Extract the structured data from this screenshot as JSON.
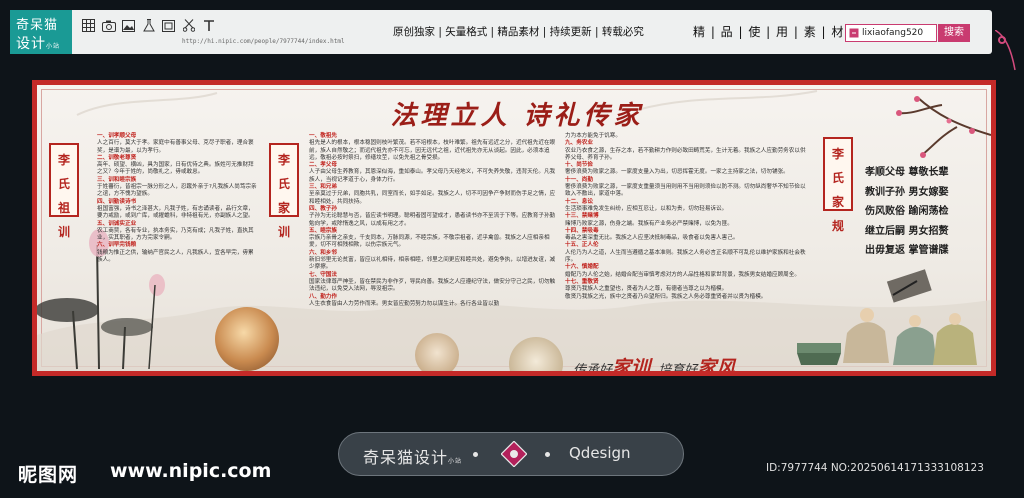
{
  "brand": {
    "line1": "奇呆猫",
    "line2": "设计",
    "line2_small": "小站"
  },
  "toolbar": {
    "icons": [
      "grid-icon",
      "camera-icon",
      "image-icon",
      "flask-icon",
      "frame-icon",
      "cut-icon",
      "text-icon"
    ],
    "url": "http://hi.nipic.com/people/7977744/index.html",
    "slogan": "原创独家 | 矢量格式 | 精品素材 | 持续更新 | 转载必究",
    "categories": "精 | 品 | 使 | 用 | 素 | 材",
    "search_value": "lixiaofang520",
    "search_button": "搜索"
  },
  "board": {
    "title": "法理立人  诗礼传家",
    "tabs": {
      "left": [
        "李",
        "氏",
        "祖",
        "训"
      ],
      "mid": [
        "李",
        "氏",
        "家",
        "训"
      ],
      "right": [
        "李",
        "氏",
        "家",
        "规"
      ]
    },
    "col1": [
      {
        "h": "一、训孝顺父母",
        "t": "人之百行，莫大于孝。家庭中有善事父母、克尽子职者，理合褒奖，是谱为最，以为孝行。"
      },
      {
        "h": "二、训敬老尊贤",
        "t": "高年、硕望、横凶，具为国家，日有优待之典。族姓可无推财拜之又？今年于姓的，尚敬礼之，毋或敢怠。"
      },
      {
        "h": "三、训和睦宗族",
        "t": "于姓蕃衍，皆祖宗一脉分形之人，忍蹴外亲于?凡我族人尚笃宗亲之谊，方不愧为望族。"
      },
      {
        "h": "四、训勤读诗书",
        "t": "祖国富强，诗书之泽甚大，凡我子姓，有志诵读者，品行文章，要力戒励，或到广库，或擢蟾科，非特祖有光，亦副族人之望。"
      },
      {
        "h": "五、训诚实正业",
        "t": "农工商贾，各有专业，执本务实，乃克有成；凡我子姓，直执其业，实其职者，方为完家令嗣。"
      },
      {
        "h": "六、训早完钱粮",
        "t": "钱粮为惟正之供，输纳产官民之人，凡我族人，宜各早完，毋累族人。"
      }
    ],
    "col2": [
      {
        "h": "一、敬祖先",
        "t": "祖先是人的根本，根本稳固则枝叶繁茂。若不培根本，枝叶难繁。祖先有远近之分，近代祖先近在眼前，族人自然敬之；而远代祖先亦不可忘，因无远代之祖，近代祖先亦无从谈起。因此，必须本追远，敬祖必按时祭扫，修缮坟茔，以免先祖之骨受损。"
      },
      {
        "h": "二、孝父母",
        "t": "人子由父母生养教育，其恩深似海，重如泰山。孝父母乃天经地义，不可失养失敬，违背天伦。凡我族人，当视记孝道于心，身体力行。"
      },
      {
        "h": "三、和兄弟",
        "t": "至亲莫过于兄弟，同胞共乳，同室而长，如手如足。我族之人，切不可因争产争财而伤手足之情，应和睦相处，共同扶持。"
      },
      {
        "h": "四、教子孙",
        "t": "子孙为无论聪慧与否，皆应读书明理。聪明者固可望成才，愚者读书亦不至流于下等。应教育子孙勤勉向学，戒除惰逸之风，以成有用之才。"
      },
      {
        "h": "五、睦宗族",
        "t": "宗族乃亲骨之亲支，千支同本，万脉同源，不睦宗族，不敬宗祖者，近乎禽兽。我族之人应相亲相爱，切不可相残相欺，以伤宗族元气。"
      },
      {
        "h": "六、和乡邻",
        "t": "新旧邻里无论贫富，皆应以礼相待，相亲相睦，邻里之间更应和睦共处，避免争执，以增进友谊，减少摩擦。"
      },
      {
        "h": "七、守国法",
        "t": "国家法律尊严神圣，皆在禁民为非作歹，导民向善。我族之人应遵纪守法，做安分守己之民，切勿触法违纪，以免受入法网，辱没祖宗。"
      },
      {
        "h": "八、勤力作",
        "t": "人生衣食皆由人力劳作而来。男女皆应勤劳努力勿以谋生计。各行各业皆以勤"
      }
    ],
    "col3": [
      {
        "h": "",
        "t": "力为本方能免于饥寒。"
      },
      {
        "h": "九、务农业",
        "t": "农业乃衣食之源，生存之本，若不勤耕力作则必致田畴荒芜，生计无着。我族之人应勤劳务农以供养父母、养育子孙。"
      },
      {
        "h": "十、尚节俭",
        "t": "奢侈浪费为败家之源。一家度支量入为出，切忌挥霍无度。一家之主持家之法，切勿铺张。"
      },
      {
        "h": "十一、尚勤",
        "t": "奢侈浪费为败家之源，一家度支重量须当用则用不当用则须俭以防不测。切勿纵尚奢华不知节俭以致入不敷出，家道中落。"
      },
      {
        "h": "十二、息讼",
        "t": "生活琐事难免发生纠纷，应相互忍让，以和为贵，切勿轻易诉讼。"
      },
      {
        "h": "十三、禁赌博",
        "t": "赌博乃败家之源，伤身之端。我族有产业务必严禁赌博，以免为匪。"
      },
      {
        "h": "十四、禁吸毒",
        "t": "毒品之害深重无比。我族之人应坚决抵制毒品，吸食者以免害人害己。"
      },
      {
        "h": "十五、正人伦",
        "t": "人伦乃为人之道，人生而当遵循之基本准则。我族之人务必言正名顺不可乱伦以维护家族和社会秩序。"
      },
      {
        "h": "十六、慎婚配",
        "t": "婚配乃为人伦之始，结婚合配当审慎考虑对方的人品性格和家世背景，我族男女结婚应顾周全。"
      },
      {
        "h": "十七、重敬贤",
        "t": "尊贤乃我族人之重望也，贤者为人之尊，有德者当尊之以为楷模。"
      },
      {
        "h": "",
        "t": "敬贤乃我族之光，族中之贤者乃众望所归。我族之人务必尊重贤者并以贤为楷模。"
      }
    ],
    "creed": [
      "孝顺父母  尊敬长辈",
      "教训子孙  男女嫁娶",
      "伤风败俗  踰闲荡检",
      "继立后嗣  男女招赘",
      "出毋复返  掌管谱牒"
    ],
    "motto": {
      "a": "传承好",
      "b": "家训",
      "c": "培育好",
      "d": "家风"
    }
  },
  "bottom": {
    "brand": "奇呆猫设计",
    "brand_small": "小站",
    "name": "Qdesign"
  },
  "watermark": {
    "logo": "昵图网",
    "url": "www.nipic.com"
  },
  "image_id": "ID:7977744 NO:20250614171333108123",
  "colors": {
    "accent": "#c93b70",
    "brand_teal": "#1a9a95",
    "board_red": "#c42a28"
  }
}
